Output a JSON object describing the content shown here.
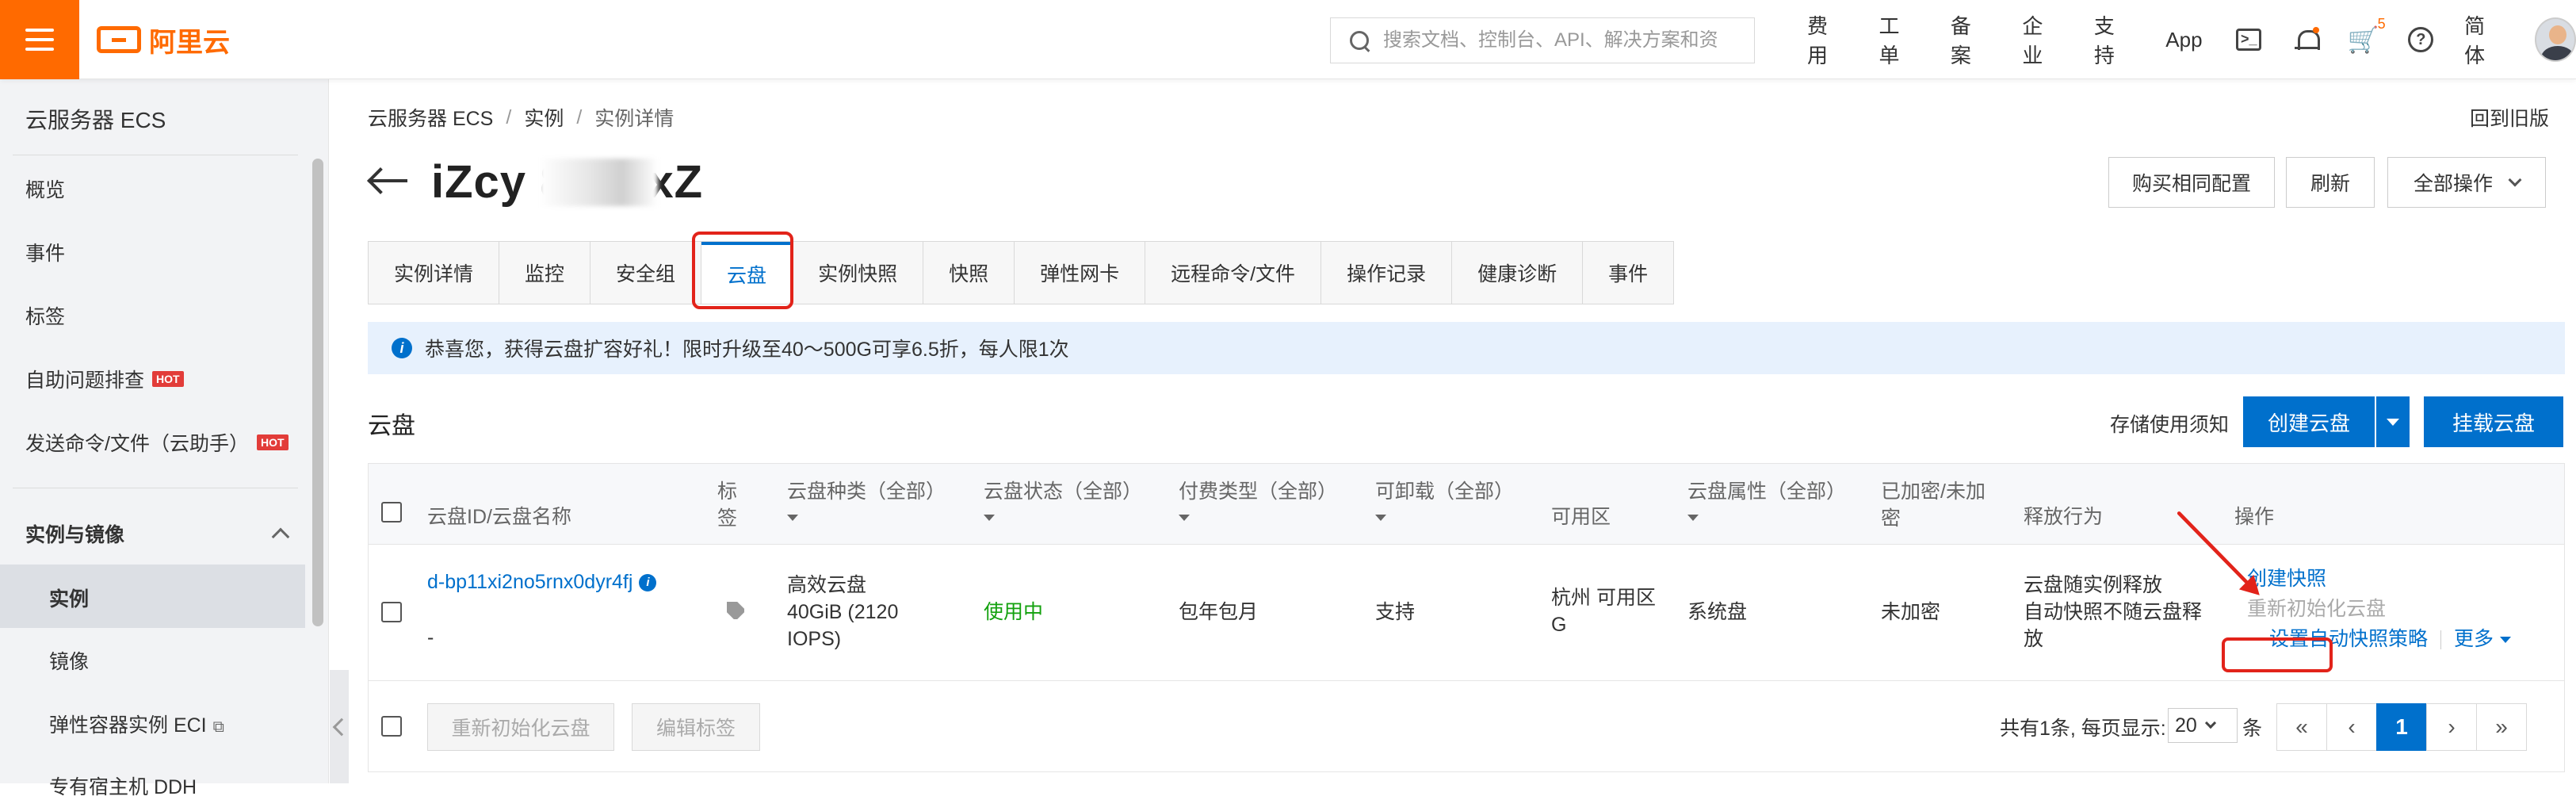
{
  "topbar": {
    "logo_text": "阿里云",
    "search_placeholder": "搜索文档、控制台、API、解决方案和资",
    "nav": [
      "费用",
      "工单",
      "备案",
      "企业",
      "支持",
      "App"
    ],
    "cart_badge": "5",
    "lang": "简体",
    "terminal_glyph": ">_",
    "help_glyph": "?",
    "cart_glyph": "🛒"
  },
  "sidebar": {
    "title": "云服务器 ECS",
    "items": [
      "概览",
      "事件",
      "标签"
    ],
    "items_hot": [
      "自助问题排查",
      "发送命令/文件（云助手）"
    ],
    "hot_label": "HOT",
    "group": "实例与镜像",
    "sub_items": [
      "实例",
      "镜像",
      "弹性容器实例 ECI",
      "专有宿主机 DDH"
    ],
    "ext_glyph": "⧉"
  },
  "breadcrumb": [
    "云服务器 ECS",
    "实例",
    "实例详情"
  ],
  "breadcrumb_sep": "/",
  "old_version": "回到旧版",
  "instance_title": "iZcy    8knxxZ",
  "header_buttons": [
    "购买相同配置",
    "刷新",
    "全部操作"
  ],
  "tabs": [
    "实例详情",
    "监控",
    "安全组",
    "云盘",
    "实例快照",
    "快照",
    "弹性网卡",
    "远程命令/文件",
    "操作记录",
    "健康诊断",
    "事件"
  ],
  "active_tab": "云盘",
  "notice": {
    "icon_glyph": "i",
    "text": "恭喜您，获得云盘扩容好礼！限时升级至40～500G可享6.5折，每人限1次"
  },
  "section": {
    "title": "云盘",
    "doc_link": "存储使用须知",
    "create_btn": "创建云盘",
    "attach_btn": "挂载云盘"
  },
  "table": {
    "headers": [
      "云盘ID/云盘名称",
      "标\n签",
      "云盘种类（全部）",
      "云盘状态（全部）",
      "付费类型（全部）",
      "可卸载（全部）",
      "可用区",
      "云盘属性（全部）",
      "已加密/未加\n密",
      "释放行为",
      "操作"
    ],
    "row": {
      "disk_id": "d-bp11xi2no5rnx0dyr4fj",
      "disk_id_badge": "i",
      "disk_name": "-",
      "type": "高效云盘\n40GiB (2120\nIOPS)",
      "status": "使用中",
      "billing": "包年包月",
      "detachable": "支持",
      "zone": "杭州 可用区\nG",
      "attribute": "系统盘",
      "encryption": "未加密",
      "release": "云盘随实例释放\n自动快照不随云盘释\n放",
      "actions": {
        "create_snapshot": "创建快照",
        "reinit": "重新初始化云盘",
        "auto_snapshot": "设置自动快照策略",
        "more": "更多"
      }
    }
  },
  "footer": {
    "reinit_btn": "重新初始化云盘",
    "edit_tag_btn": "编辑标签",
    "total_text": "共有1条, 每页显示:",
    "page_size": "20",
    "unit": "条",
    "pages": [
      "«",
      "‹",
      "1",
      "›",
      "»"
    ]
  },
  "colors": {
    "brand": "#ff6a00",
    "primary": "#0070cc",
    "highlight": "#e2231a",
    "status_green": "#13a10e"
  }
}
